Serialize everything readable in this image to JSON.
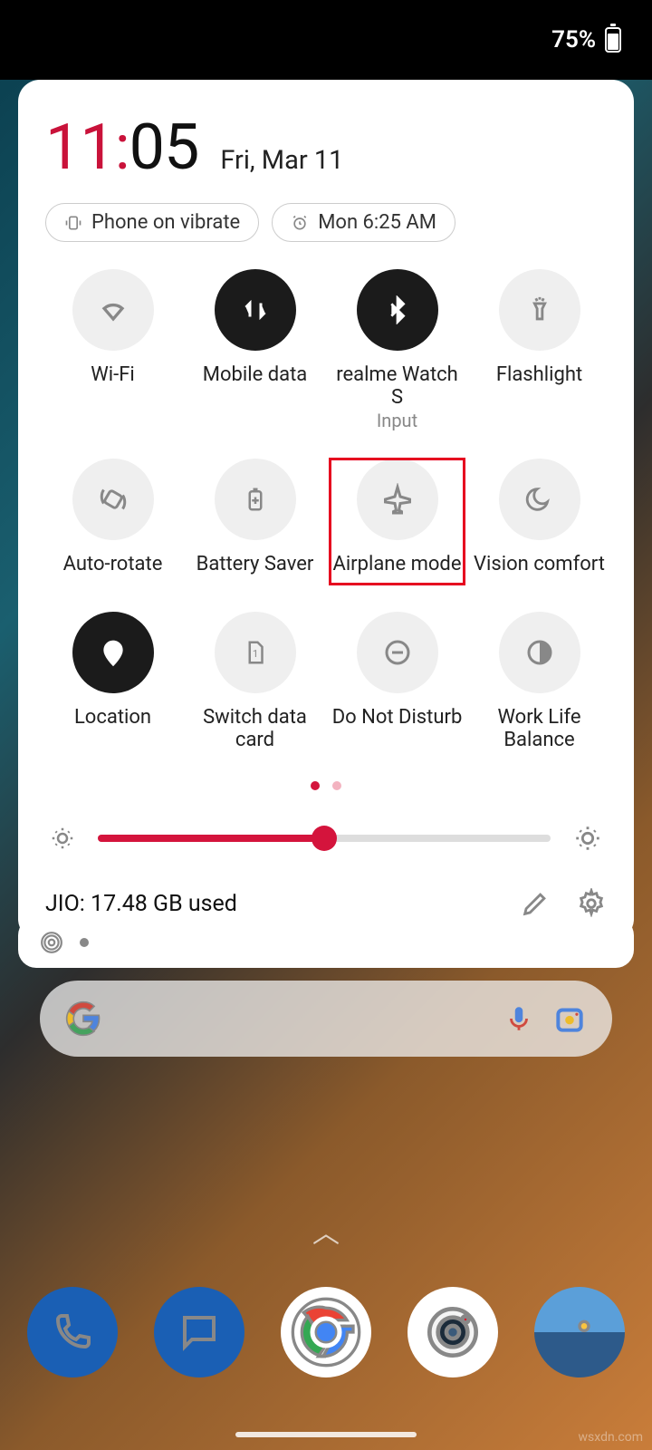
{
  "status_bar": {
    "battery_pct": "75%"
  },
  "panel": {
    "clock": {
      "hour": "11",
      "minute": "05"
    },
    "date": "Fri, Mar 11",
    "chips": {
      "vibrate": "Phone on vibrate",
      "alarm": "Mon 6:25 AM"
    },
    "tiles": [
      {
        "id": "wifi",
        "label": "Wi-Fi",
        "sub": "",
        "active": false
      },
      {
        "id": "mobile-data",
        "label": "Mobile data",
        "sub": "",
        "active": true
      },
      {
        "id": "bluetooth",
        "label": "realme Watch S",
        "sub": "Input",
        "active": true
      },
      {
        "id": "flashlight",
        "label": "Flashlight",
        "sub": "",
        "active": false
      },
      {
        "id": "autorotate",
        "label": "Auto-rotate",
        "sub": "",
        "active": false
      },
      {
        "id": "batt-saver",
        "label": "Battery Saver",
        "sub": "",
        "active": false
      },
      {
        "id": "airplane",
        "label": "Airplane mode",
        "sub": "",
        "active": false,
        "highlight": true
      },
      {
        "id": "vision",
        "label": "Vision comfort",
        "sub": "",
        "active": false
      },
      {
        "id": "location",
        "label": "Location",
        "sub": "",
        "active": true
      },
      {
        "id": "switch-sim",
        "label": "Switch data card",
        "sub": "",
        "active": false
      },
      {
        "id": "dnd",
        "label": "Do Not Disturb",
        "sub": "",
        "active": false
      },
      {
        "id": "worklife",
        "label": "Work Life Balance",
        "sub": "",
        "active": false
      }
    ],
    "brightness_pct": 50,
    "footer": {
      "data_usage": "JIO: 17.48 GB used"
    }
  },
  "dock": {
    "apps": [
      "phone",
      "messages",
      "chrome",
      "camera",
      "files"
    ]
  },
  "watermark": "wsxdn.com"
}
